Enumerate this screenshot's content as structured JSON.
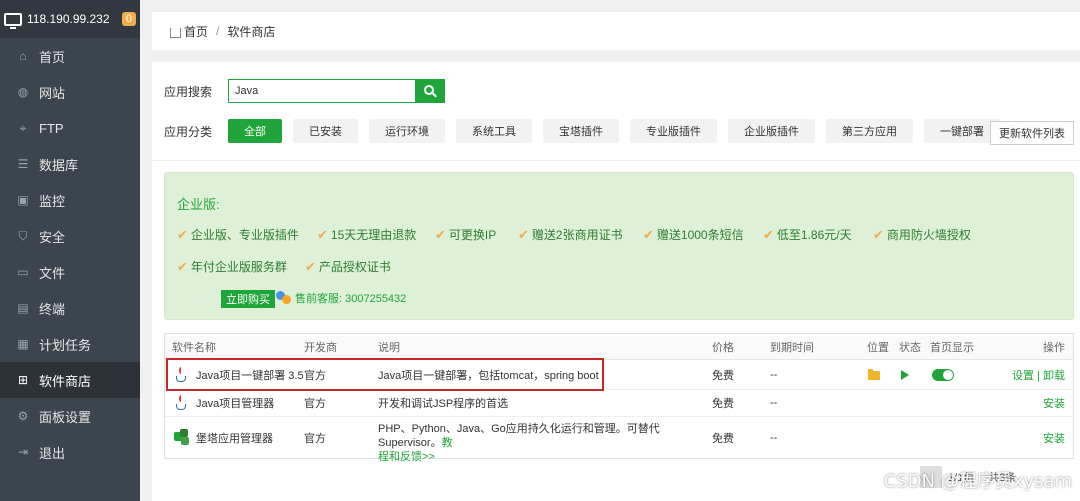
{
  "sidebar": {
    "ip": "118.190.99.232",
    "badge": "0",
    "items": [
      {
        "label": "首页",
        "icon": "home-icon"
      },
      {
        "label": "网站",
        "icon": "globe-icon"
      },
      {
        "label": "FTP",
        "icon": "ftp-icon"
      },
      {
        "label": "数据库",
        "icon": "database-icon"
      },
      {
        "label": "监控",
        "icon": "monitor-icon"
      },
      {
        "label": "安全",
        "icon": "shield-icon"
      },
      {
        "label": "文件",
        "icon": "folder-icon"
      },
      {
        "label": "终端",
        "icon": "terminal-icon"
      },
      {
        "label": "计划任务",
        "icon": "calendar-icon"
      },
      {
        "label": "软件商店",
        "icon": "grid-icon"
      },
      {
        "label": "面板设置",
        "icon": "gear-icon"
      },
      {
        "label": "退出",
        "icon": "logout-icon"
      }
    ]
  },
  "breadcrumb": {
    "home": "首页",
    "sep": "/",
    "current": "软件商店"
  },
  "search": {
    "label": "应用搜索",
    "value": "Java"
  },
  "categories": {
    "label": "应用分类",
    "items": [
      "全部",
      "已安装",
      "运行环境",
      "系统工具",
      "宝塔插件",
      "专业版插件",
      "企业版插件",
      "第三方应用",
      "一键部署"
    ],
    "refresh": "更新软件列表"
  },
  "enterprise": {
    "title": "企业版:",
    "features_row1": [
      "企业版、专业版插件",
      "15天无理由退款",
      "可更换IP",
      "赠送2张商用证书",
      "赠送1000条短信",
      "低至1.86元/天",
      "商用防火墙授权"
    ],
    "features_row2": [
      "年付企业版服务群",
      "产品授权证书"
    ],
    "buy": "立即购买",
    "service": "售前客服: 3007255432"
  },
  "table": {
    "headers": [
      "软件名称",
      "开发商",
      "说明",
      "价格",
      "到期时间",
      "位置",
      "状态",
      "首页显示",
      "操作"
    ],
    "rows": [
      {
        "name": "Java项目一键部署 3.5",
        "dev": "官方",
        "desc": "Java项目一键部署，包括tomcat，spring boot",
        "price": "免费",
        "expire": "--",
        "action1": "设置",
        "action_sep": "|",
        "action2": "卸载"
      },
      {
        "name": "Java项目管理器",
        "dev": "官方",
        "desc": "开发和调试JSP程序的首选",
        "price": "免费",
        "expire": "--",
        "action1": "安装"
      },
      {
        "name": "堡塔应用管理器",
        "dev": "官方",
        "desc": "PHP、Python、Java、Go应用持久化运行和管理。可替代Supervisor。",
        "desc_link1": "教",
        "desc_link2": "程和反馈>>",
        "price": "免费",
        "expire": "--",
        "action1": "安装"
      }
    ]
  },
  "pager": {
    "text1": "1/1页",
    "text2": "共3条"
  },
  "watermark": "CSDN @程序员xysam",
  "colors": {
    "accent": "#20a53a",
    "sidebar": "#3c444d",
    "highlight": "#c62828"
  }
}
